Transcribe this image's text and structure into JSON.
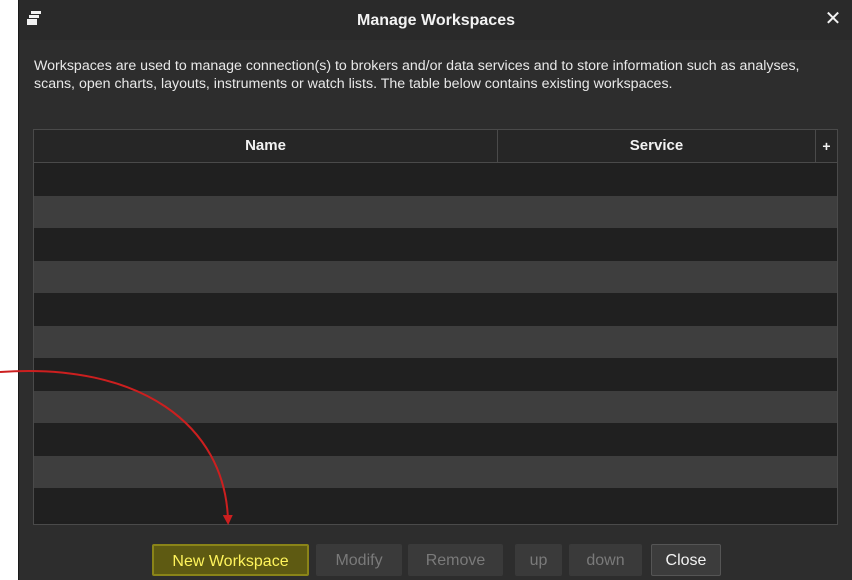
{
  "dialog": {
    "title": "Manage Workspaces",
    "close_symbol": "✕",
    "description": "Workspaces are used to manage connection(s) to brokers and/or data services and to store information such as analyses, scans, open charts, layouts, instruments or watch lists. The table below contains existing workspaces."
  },
  "table": {
    "columns": [
      "Name",
      "Service"
    ],
    "add_column_symbol": "+",
    "rows": []
  },
  "buttons": {
    "new_workspace": "New Workspace",
    "modify": "Modify",
    "remove": "Remove",
    "up": "up",
    "down": "down",
    "close": "Close"
  },
  "colors": {
    "dialog_bg": "#2d2d2d",
    "highlight_text": "#fff45c",
    "annotation_arrow": "#cc1f1f"
  },
  "icons": {
    "app": "window-stack-icon",
    "close": "close-icon",
    "add_column": "plus-icon"
  }
}
